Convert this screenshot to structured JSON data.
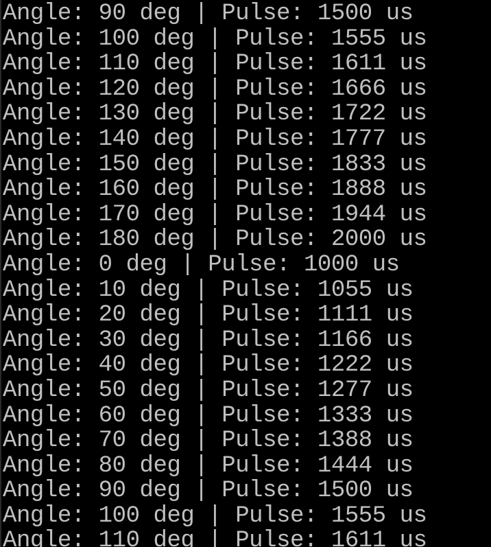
{
  "terminal": {
    "colors": {
      "background": "#000000",
      "text": "#c0c0c0"
    },
    "lines": [
      "Angle: 90 deg | Pulse: 1500 us",
      "Angle: 100 deg | Pulse: 1555 us",
      "Angle: 110 deg | Pulse: 1611 us",
      "Angle: 120 deg | Pulse: 1666 us",
      "Angle: 130 deg | Pulse: 1722 us",
      "Angle: 140 deg | Pulse: 1777 us",
      "Angle: 150 deg | Pulse: 1833 us",
      "Angle: 160 deg | Pulse: 1888 us",
      "Angle: 170 deg | Pulse: 1944 us",
      "Angle: 180 deg | Pulse: 2000 us",
      "Angle: 0 deg | Pulse: 1000 us",
      "Angle: 10 deg | Pulse: 1055 us",
      "Angle: 20 deg | Pulse: 1111 us",
      "Angle: 30 deg | Pulse: 1166 us",
      "Angle: 40 deg | Pulse: 1222 us",
      "Angle: 50 deg | Pulse: 1277 us",
      "Angle: 60 deg | Pulse: 1333 us",
      "Angle: 70 deg | Pulse: 1388 us",
      "Angle: 80 deg | Pulse: 1444 us",
      "Angle: 90 deg | Pulse: 1500 us",
      "Angle: 100 deg | Pulse: 1555 us",
      "Angle: 110 deg | Pulse: 1611 us"
    ]
  }
}
